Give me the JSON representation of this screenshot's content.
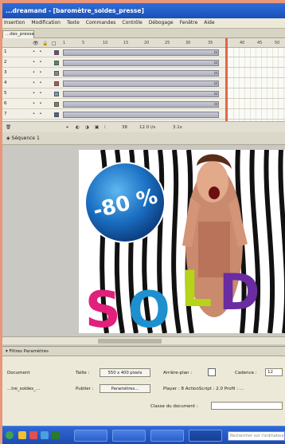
{
  "window": {
    "title": "...dreamand - [baromètre_soldes_presse]"
  },
  "menu": [
    "Insertion",
    "Modification",
    "Texte",
    "Commandes",
    "Contrôle",
    "Débogage",
    "Fenêtre",
    "Aide"
  ],
  "doc_tab": "...des_presse",
  "timeline": {
    "frame_numbers": [
      "5",
      "10",
      "15",
      "20",
      "25",
      "30",
      "35",
      "40",
      "45",
      "50"
    ],
    "layers": [
      {
        "name": "1",
        "swatch": "#7a3ea0"
      },
      {
        "name": "2",
        "swatch": "#3aa048"
      },
      {
        "name": "3",
        "swatch": "#8a8a8a"
      },
      {
        "name": "4",
        "swatch": "#c05050"
      },
      {
        "name": "5",
        "swatch": "#6aa0c8"
      },
      {
        "name": "6",
        "swatch": "#9a7a40"
      },
      {
        "name": "7",
        "swatch": "#4060c0"
      }
    ],
    "footer": {
      "frame": "38",
      "fps": "12.0 i/s",
      "time": "3.1s"
    }
  },
  "scene": {
    "label": "Séquence 1"
  },
  "stage_art": {
    "badge_text": "-80 %",
    "word": "SOLDES"
  },
  "properties": {
    "tabs": "▾ Filtres  Paramètres",
    "doc_label": "Document",
    "doc_name": "...tre_soldes_...",
    "size_label": "Taille :",
    "size_value": "550 x 400 pixels",
    "bg_label": "Arrière-plan :",
    "fps_label": "Cadence :",
    "fps_value": "12",
    "publish_label": "Publier :",
    "params_button": "Paramètres...",
    "player_text": "Player : 8   ActionScript : 2.0   Profil : ...",
    "class_label": "Classe du document :"
  },
  "taskbar": {
    "search_placeholder": "Rechercher sur l'ordinateur"
  }
}
